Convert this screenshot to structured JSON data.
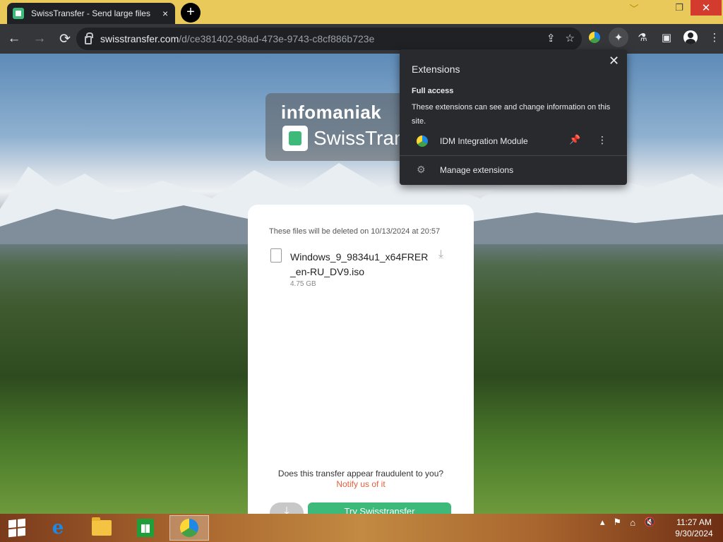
{
  "browser": {
    "tab": {
      "title": "SwissTransfer - Send large files",
      "close_label": "×"
    },
    "new_tab_label": "+",
    "window_controls": {
      "minimize": "﹀",
      "maximize": "❐",
      "close": "✕"
    },
    "nav": {
      "back": "←",
      "forward": "→",
      "reload": "⟳"
    },
    "address": {
      "host": "swisstransfer.com",
      "path": "/d/ce381402-98ad-473e-9743-c8cf886b723e"
    }
  },
  "extensions_popup": {
    "title": "Extensions",
    "close_label": "✕",
    "section_title": "Full access",
    "section_desc": "These extensions can see and change information on this site.",
    "items": [
      {
        "name": "IDM Integration Module",
        "pinned": true
      }
    ],
    "manage_label": "Manage extensions"
  },
  "page": {
    "brand_top": "infomaniak",
    "brand_name": "SwissTransfer",
    "card": {
      "deletion_notice": "These files will be deleted on 10/13/2024 at 20:57",
      "file": {
        "name": "Windows_9_9834u1_x64FRER_en-RU_DV9.iso",
        "size": "4.75 GB"
      },
      "fraud_text": "Does this transfer appear fraudulent to you?",
      "fraud_link": "Notify us of it",
      "try_button": "Try Swisstransfer"
    }
  },
  "taskbar": {
    "clock_time": "11:27 AM",
    "clock_date": "9/30/2024"
  },
  "colors": {
    "accent": "#3dba7a",
    "link": "#e45d3a",
    "tabstrip": "#e8c95a",
    "popup_bg": "#292a2d"
  }
}
